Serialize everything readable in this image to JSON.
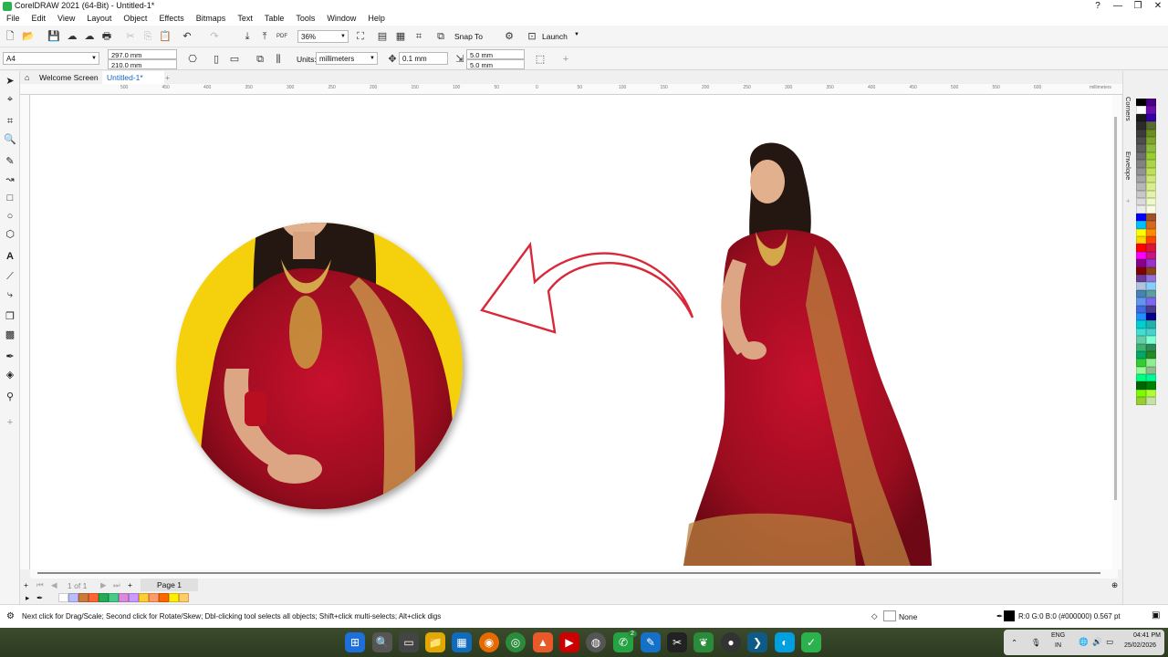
{
  "window": {
    "title": "CorelDRAW 2021 (64-Bit) - Untitled-1*",
    "controls": [
      "?",
      "—",
      "❐",
      "✕"
    ]
  },
  "menu": [
    "File",
    "Edit",
    "View",
    "Layout",
    "Object",
    "Effects",
    "Bitmaps",
    "Text",
    "Table",
    "Tools",
    "Window",
    "Help"
  ],
  "toolbar": {
    "zoom": "36%",
    "snap_to": "Snap To",
    "launch": "Launch",
    "pdf_label": "PDF"
  },
  "property_bar": {
    "page_size": "A4",
    "width": "297.0 mm",
    "height": "210.0 mm",
    "units_label": "Units:",
    "units": "millimeters",
    "nudge": "0.1 mm",
    "dup_x": "5.0 mm",
    "dup_y": "5.0 mm"
  },
  "tabs": {
    "welcome": "Welcome Screen",
    "document": "Untitled-1*"
  },
  "ruler": {
    "ticks": [
      "500",
      "450",
      "400",
      "350",
      "300",
      "250",
      "200",
      "150",
      "100",
      "50",
      "0",
      "50",
      "100",
      "150",
      "200",
      "250",
      "300",
      "350",
      "400",
      "450",
      "500",
      "550",
      "600"
    ],
    "unit": "millimeters"
  },
  "dockers": {
    "corners": "Corners",
    "envelope": "Envelope"
  },
  "page_nav": {
    "counter": "1",
    "of": "of",
    "total": "1",
    "page_tab": "Page 1"
  },
  "status": {
    "hint": "Next click for Drag/Scale; Second click for Rotate/Skew; Dbl-clicking tool selects all objects; Shift+click multi-selects; Alt+click digs",
    "fill": "None",
    "outline": "R:0 G:0 B:0 (#000000)  0.567 pt"
  },
  "taskbar": {
    "lang": "ENG",
    "region": "IN",
    "time": "04:41 PM",
    "date": "25/02/2026",
    "notification_badge": "2"
  },
  "palette_colors": [
    "#000000",
    "#4b0082",
    "#ffffff",
    "#6a0dad",
    "#1a1a1a",
    "#3300aa",
    "#2b2b2b",
    "#556b2f",
    "#3c3c3c",
    "#6b8e23",
    "#4d4d4d",
    "#7fa32f",
    "#5e5e5e",
    "#8fbc3f",
    "#707070",
    "#99cc33",
    "#828282",
    "#aad44a",
    "#939393",
    "#bfe05a",
    "#a5a5a5",
    "#cfe87a",
    "#b7b7b7",
    "#d9ee90",
    "#c8c8c8",
    "#e4f3aa",
    "#dadada",
    "#eef8c8",
    "#ebebeb",
    "#f7fce3",
    "#0000ff",
    "#a0522d",
    "#00bfff",
    "#d2691e",
    "#ffff00",
    "#ff8c00",
    "#ffd700",
    "#ff4500",
    "#ff0000",
    "#dc143c",
    "#ff00ff",
    "#c71585",
    "#8b008b",
    "#9932cc",
    "#800000",
    "#8b4513",
    "#6a3d9a",
    "#9370db",
    "#b0c4de",
    "#87cefa",
    "#4682b4",
    "#5f9ea0",
    "#6495ed",
    "#7b68ee",
    "#4169e1",
    "#483d8b",
    "#1e90ff",
    "#00008b",
    "#00ced1",
    "#20b2aa",
    "#40e0d0",
    "#48d1cc",
    "#66cdaa",
    "#7fffd4",
    "#3cb371",
    "#2e8b57",
    "#00a86b",
    "#228b22",
    "#32cd32",
    "#90ee90",
    "#98fb98",
    "#8fbc8f",
    "#00ff7f",
    "#00fa9a",
    "#006400",
    "#008000",
    "#7cfc00",
    "#adff2f",
    "#9acd32",
    "#c5e1a5"
  ],
  "doc_palette": [
    "#ffffff",
    "#bbbbff",
    "#cc7a3a",
    "#ff6633",
    "#22aa55",
    "#44cc88",
    "#dd88dd",
    "#cc99ff",
    "#ffcc33",
    "#ff9966",
    "#ff6600",
    "#ffee00",
    "#ffcc66"
  ]
}
